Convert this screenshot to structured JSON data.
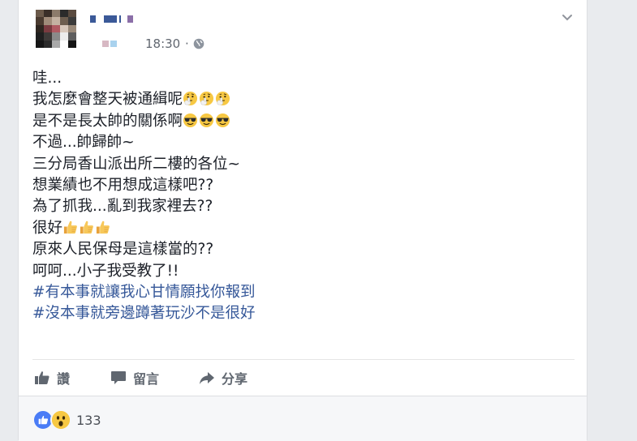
{
  "post": {
    "timestamp": "18:30",
    "separator": "·",
    "privacy_icon": "globe-icon",
    "menu_icon": "chevron-down-icon",
    "lines": [
      {
        "text": "哇...",
        "emoji": []
      },
      {
        "text": "我怎麼會整天被通緝呢",
        "emoji": [
          "thinking-emoji",
          "thinking-emoji",
          "thinking-emoji"
        ]
      },
      {
        "text": "是不是長太帥的關係啊",
        "emoji": [
          "sunglasses-emoji",
          "sunglasses-emoji",
          "sunglasses-emoji"
        ]
      },
      {
        "text": "不過...帥歸帥~",
        "emoji": []
      },
      {
        "text": "三分局香山派出所二樓的各位~",
        "emoji": []
      },
      {
        "text": "想業績也不用想成這樣吧??",
        "emoji": []
      },
      {
        "text": "為了抓我...亂到我家裡去??",
        "emoji": []
      },
      {
        "text": "很好",
        "emoji": [
          "thumbs-up-emoji",
          "thumbs-up-emoji",
          "thumbs-up-emoji"
        ]
      },
      {
        "text": "原來人民保母是這樣當的??",
        "emoji": []
      },
      {
        "text": "呵呵...小子我受教了!!",
        "emoji": []
      }
    ],
    "hashtags": [
      "#有本事就讓我心甘情願找你報到",
      "#沒本事就旁邊蹲著玩沙不是很好"
    ]
  },
  "actions": {
    "like_label": "讚",
    "comment_label": "留言",
    "share_label": "分享"
  },
  "reactions": {
    "icons": [
      "like-reaction-icon",
      "wow-reaction-icon"
    ],
    "count": "133"
  },
  "colors": {
    "link": "#365899",
    "text": "#1d2129",
    "muted": "#616770",
    "like_blue": "#4a7cf6",
    "wow_yellow": "#f7c843"
  }
}
